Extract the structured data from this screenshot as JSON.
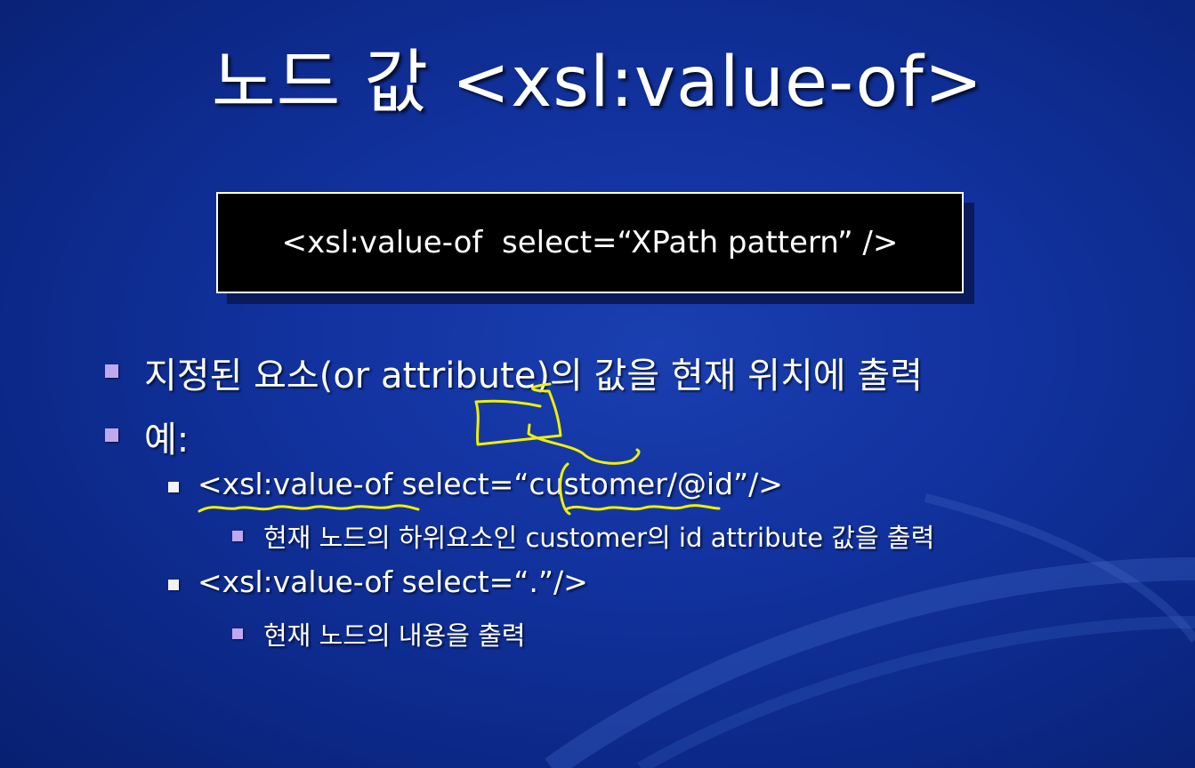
{
  "slide": {
    "title": "노드 값 <xsl:value-of>",
    "syntax": "<xsl:value-of  select=“XPath pattern” />",
    "bullets": [
      {
        "text": "지정된 요소(or attribute)의 값을 현재 위치에 출력"
      },
      {
        "text": "예:"
      }
    ],
    "examples": [
      {
        "code": "<xsl:value-of select=“customer/@id”/>",
        "desc": "현재 노드의 하위요소인 customer의 id attribute 값을 출력"
      },
      {
        "code": "<xsl:value-of select=“.”/>",
        "desc": "현재 노드의 내용을 출력"
      }
    ]
  },
  "colors": {
    "background": "#1233a0",
    "bullet_primary": "#c0a8f0",
    "bullet_secondary": "#f2f2f2",
    "annotation": "#f0f000"
  }
}
